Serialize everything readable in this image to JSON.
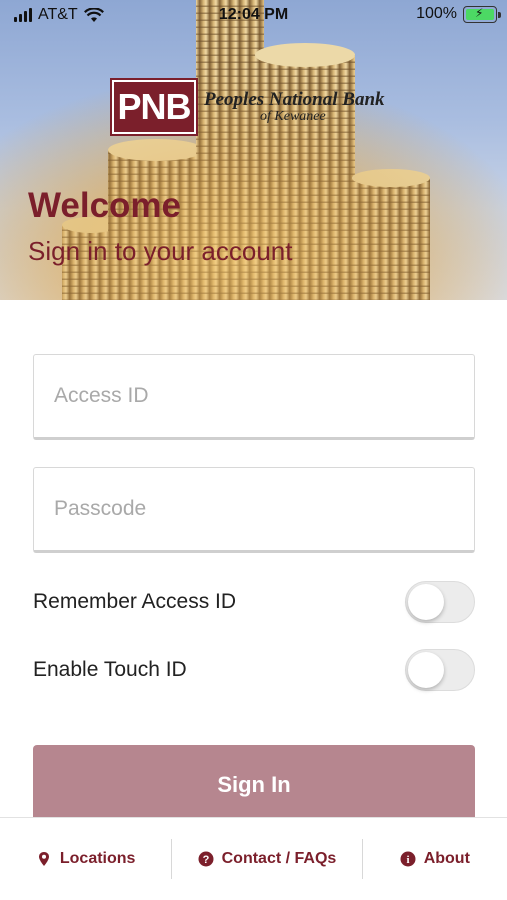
{
  "status_bar": {
    "carrier": "AT&T",
    "time": "12:04 PM",
    "battery": "100%"
  },
  "logo": {
    "mark": "PNB",
    "name": "Peoples National Bank",
    "subname": "of Kewanee"
  },
  "hero": {
    "title": "Welcome",
    "subtitle": "Sign in to your account"
  },
  "form": {
    "access_id_placeholder": "Access ID",
    "passcode_placeholder": "Passcode",
    "remember_label": "Remember Access ID",
    "remember_on": false,
    "touch_label": "Enable Touch ID",
    "touch_on": false,
    "signin_label": "Sign In"
  },
  "nav": {
    "locations": "Locations",
    "contact": "Contact / FAQs",
    "about": "About"
  },
  "colors": {
    "brand": "#7b1f2b",
    "signin_button": "#b6868f"
  },
  "icons": [
    "signal-icon",
    "wifi-icon",
    "battery-icon",
    "map-pin-icon",
    "question-icon",
    "info-icon"
  ]
}
